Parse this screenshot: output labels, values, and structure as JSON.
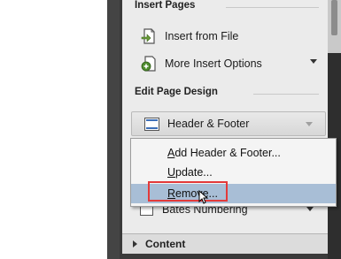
{
  "sections": {
    "insert_pages": "Insert Pages",
    "edit_page_design": "Edit Page Design",
    "content": "Content"
  },
  "items": {
    "insert_from_file": "Insert from File",
    "more_insert_options": "More Insert Options",
    "header_footer": "Header & Footer",
    "bates_numbering": "Bates Numbering"
  },
  "menu": {
    "add_pre": "",
    "add_u": "A",
    "add_post": "dd Header & Footer...",
    "update_pre": "",
    "update_u": "U",
    "update_post": "pdate...",
    "remove_pre": "",
    "remove_u": "R",
    "remove_post": "emove..."
  },
  "icons": {
    "insert_from_file": "insert-file-icon",
    "more_insert_options": "more-insert-icon",
    "header_footer": "header-footer-icon",
    "bates_numbering": "bates-numbering-icon"
  },
  "colors": {
    "hover_item": "#a8bed6",
    "highlight_box": "#e33a3a"
  }
}
